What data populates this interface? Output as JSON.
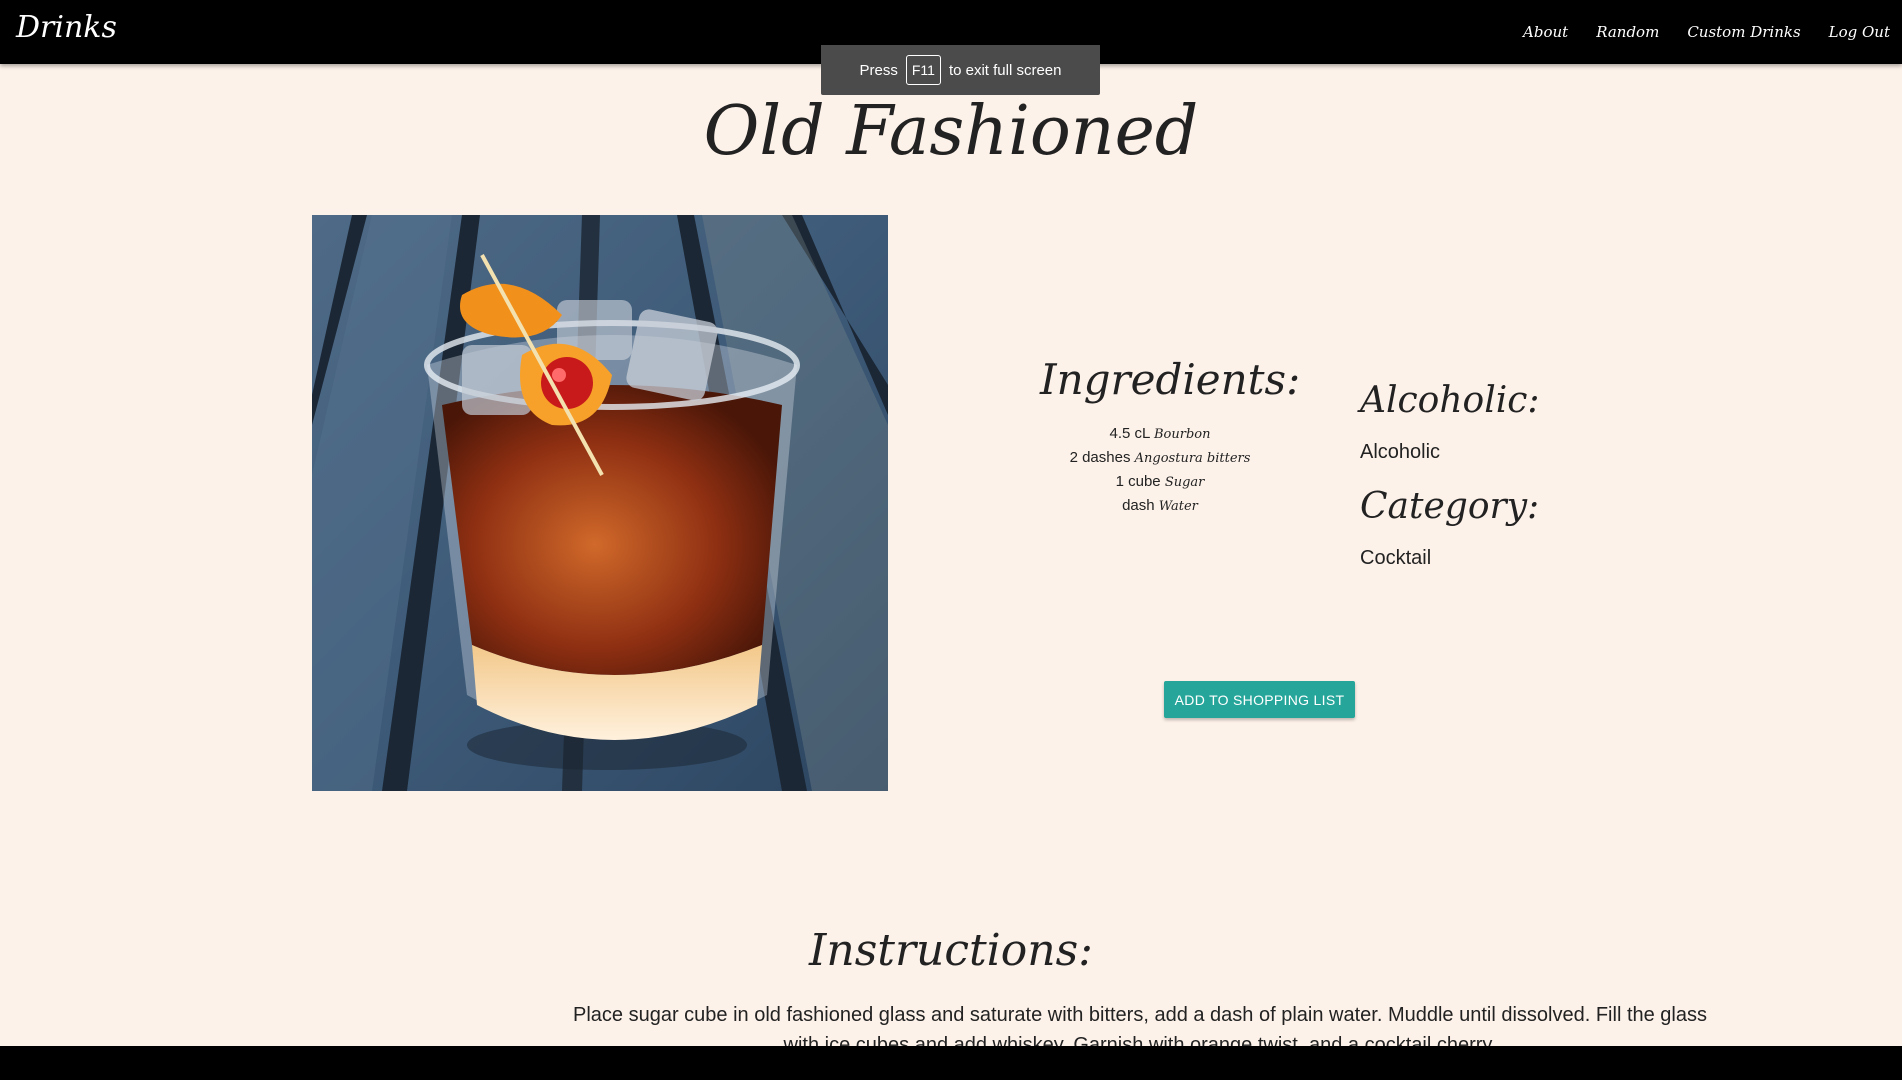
{
  "nav": {
    "brand": "Drinks",
    "links": [
      "About",
      "Random",
      "Custom Drinks",
      "Log Out"
    ]
  },
  "fullscreen_toast": {
    "prefix": "Press",
    "key": "F11",
    "suffix": "to exit full screen"
  },
  "drink": {
    "name": "Old Fashioned",
    "image_icon": "cocktail-photo",
    "ingredients_heading": "Ingredients:",
    "ingredients": [
      {
        "measure": "4.5 cL",
        "name": "Bourbon"
      },
      {
        "measure": "2 dashes",
        "name": "Angostura bitters"
      },
      {
        "measure": "1 cube",
        "name": "Sugar"
      },
      {
        "measure": "dash",
        "name": "Water"
      }
    ],
    "alcoholic_heading": "Alcoholic:",
    "alcoholic_value": "Alcoholic",
    "category_heading": "Category:",
    "category_value": "Cocktail",
    "add_button": "ADD TO SHOPPING LIST",
    "instructions_heading": "Instructions:",
    "instructions": "Place sugar cube in old fashioned glass and saturate with bitters, add a dash of plain water. Muddle until dissolved. Fill the glass with ice cubes and add whiskey. Garnish with orange twist, and a cocktail cherry."
  },
  "colors": {
    "background": "#fdf2ea",
    "nav": "#000000",
    "button": "#26a69a"
  }
}
